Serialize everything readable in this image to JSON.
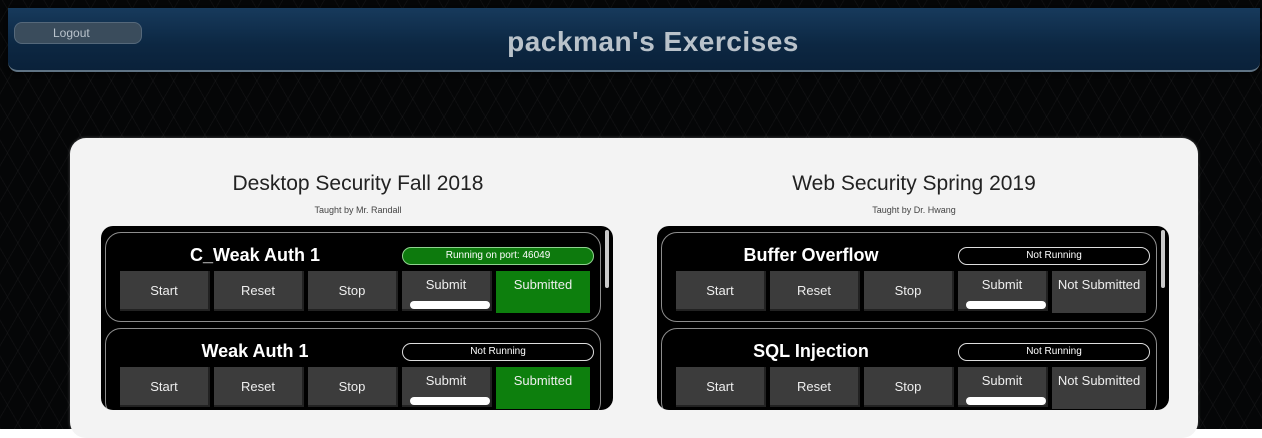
{
  "header": {
    "logout_label": "Logout",
    "page_title": "packman's Exercises"
  },
  "courses": [
    {
      "title": "Desktop Security Fall 2018",
      "teacher": "Taught by Mr. Randall",
      "exercises": [
        {
          "name": "C_Weak Auth 1",
          "status": "Running on port: 46049",
          "start": "Start",
          "reset": "Reset",
          "stop": "Stop",
          "submit": "Submit",
          "submission": "Submitted"
        },
        {
          "name": "Weak Auth 1",
          "status": "Not Running",
          "start": "Start",
          "reset": "Reset",
          "stop": "Stop",
          "submit": "Submit",
          "submission": "Submitted"
        }
      ]
    },
    {
      "title": "Web Security Spring 2019",
      "teacher": "Taught by Dr. Hwang",
      "exercises": [
        {
          "name": "Buffer Overflow",
          "status": "Not Running",
          "start": "Start",
          "reset": "Reset",
          "stop": "Stop",
          "submit": "Submit",
          "submission": "Not Submitted"
        },
        {
          "name": "SQL Injection",
          "status": "Not Running",
          "start": "Start",
          "reset": "Reset",
          "stop": "Stop",
          "submit": "Submit",
          "submission": "Not Submitted"
        }
      ]
    }
  ],
  "colors": {
    "header": "#0c2742",
    "running_status": "#0d7a0d",
    "submitted": "#0d7f0d",
    "button": "#3c3c3c"
  }
}
